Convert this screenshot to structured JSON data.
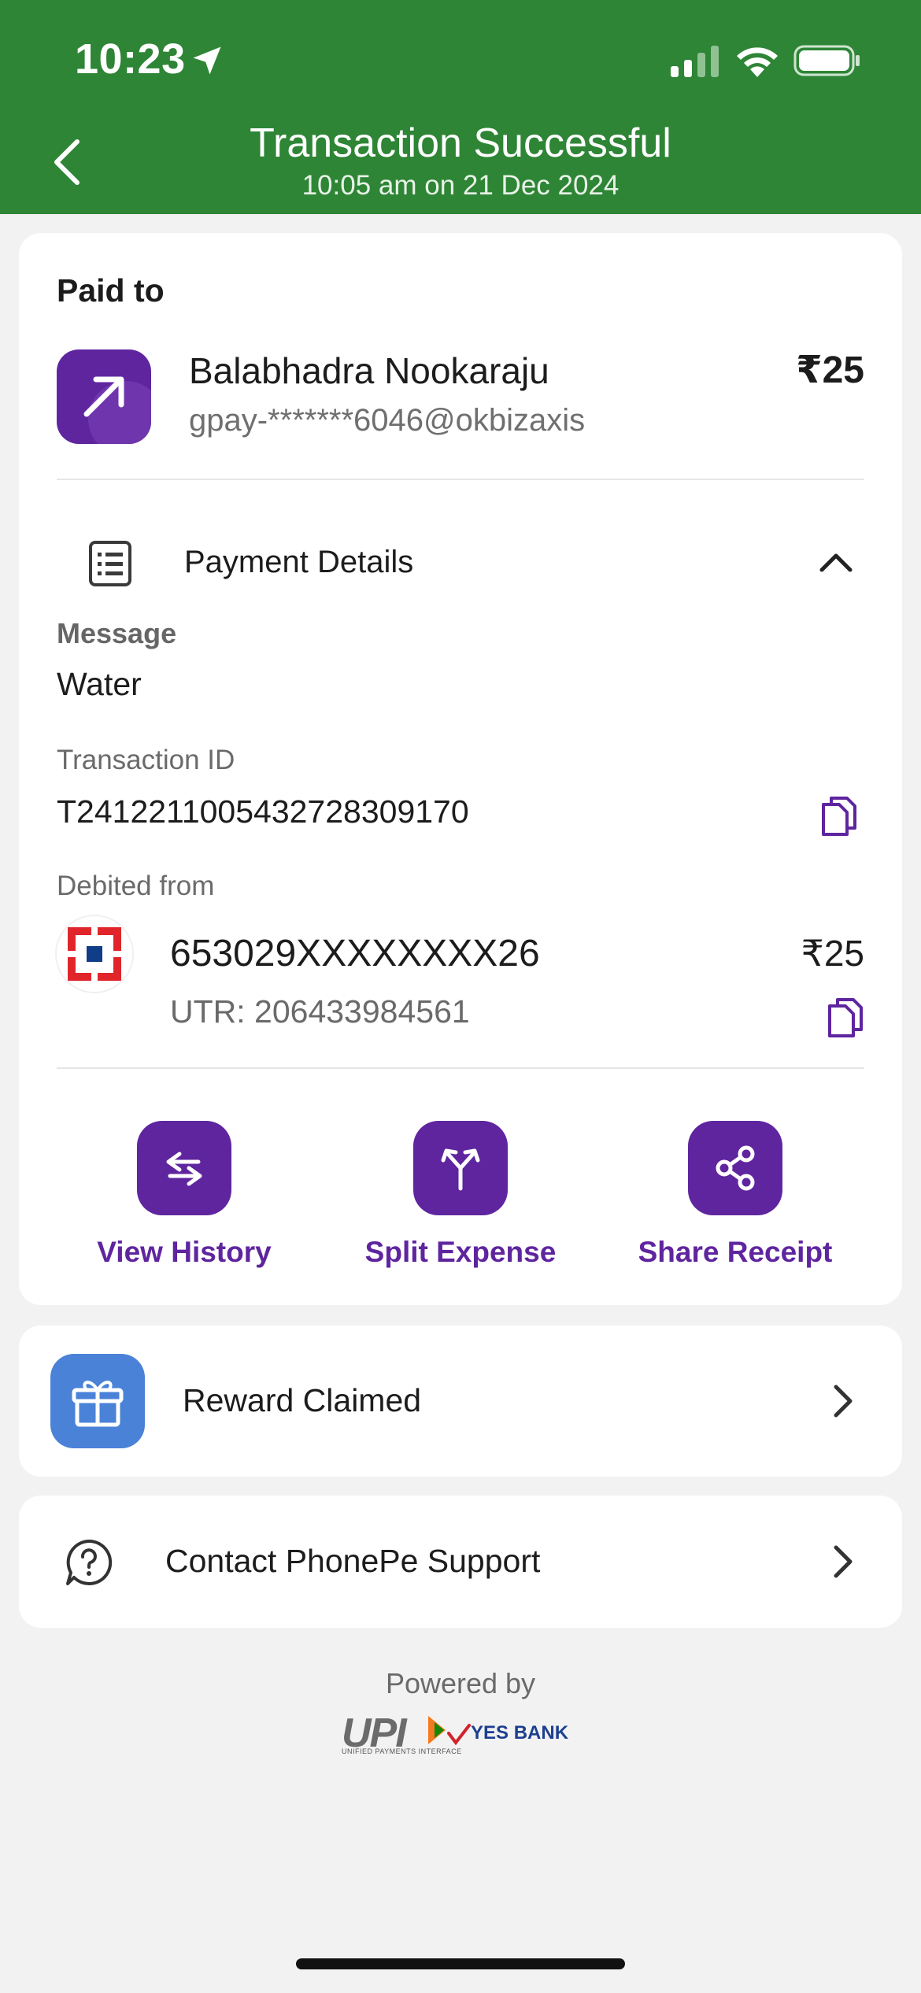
{
  "status_bar": {
    "time": "10:23"
  },
  "header": {
    "title": "Transaction Successful",
    "subtitle": "10:05 am on 21 Dec 2024",
    "bg_color": "#2e8535"
  },
  "paid_to": {
    "heading": "Paid to",
    "name": "Balabhadra Nookaraju",
    "upi_id": "gpay-*******6046@okbizaxis",
    "amount": "₹25"
  },
  "payment_details": {
    "label": "Payment Details",
    "message_label": "Message",
    "message_value": "Water",
    "txn_id_label": "Transaction ID",
    "txn_id_value": "T2412211005432728309170",
    "debited_label": "Debited from",
    "account": "653029XXXXXXXX26",
    "utr": "UTR: 206433984561",
    "debit_amount": "₹25"
  },
  "actions": [
    {
      "label": "View History",
      "icon": "arrows-swap-icon"
    },
    {
      "label": "Split Expense",
      "icon": "split-icon"
    },
    {
      "label": "Share Receipt",
      "icon": "share-icon"
    }
  ],
  "reward": {
    "label": "Reward Claimed"
  },
  "support": {
    "label": "Contact PhonePe Support"
  },
  "footer": {
    "powered_by": "Powered by",
    "upi_logo_text": "UPI",
    "upi_logo_sub": "UNIFIED PAYMENTS INTERFACE",
    "bank_logo_text": "YES BANK"
  },
  "colors": {
    "accent": "#5f259f",
    "reward": "#4a82d8"
  }
}
